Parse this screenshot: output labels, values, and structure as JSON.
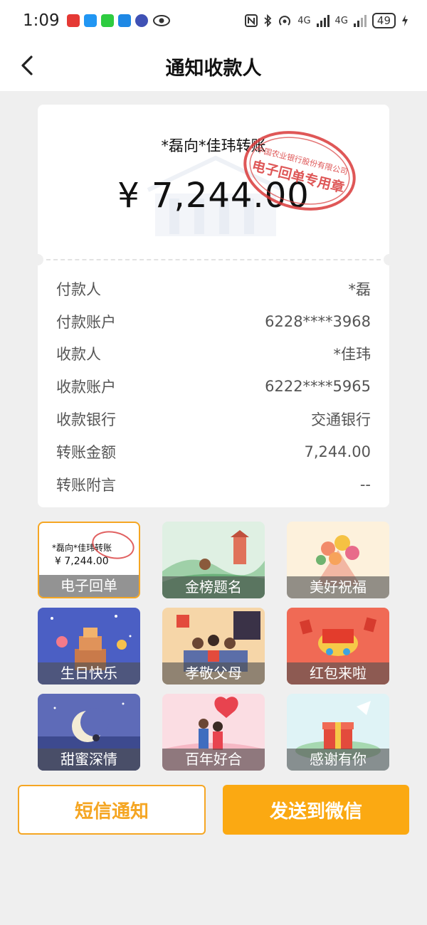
{
  "status_bar": {
    "time": "1:09",
    "network_a": "4G",
    "network_b": "4G",
    "battery": "49"
  },
  "header": {
    "title": "通知收款人"
  },
  "receipt": {
    "title": "*磊向*佳玮转账",
    "amount": "¥ 7,244.00",
    "stamp_lines": [
      "中国农业银行股份有限公司",
      "电子回单专用章"
    ],
    "rows": [
      {
        "label": "付款人",
        "value": "*磊"
      },
      {
        "label": "付款账户",
        "value": "6228****3968"
      },
      {
        "label": "收款人",
        "value": "*佳玮"
      },
      {
        "label": "收款账户",
        "value": "6222****5965"
      },
      {
        "label": "收款银行",
        "value": "交通银行"
      },
      {
        "label": "转账金额",
        "value": "7,244.00"
      },
      {
        "label": "转账附言",
        "value": "--"
      }
    ]
  },
  "templates": [
    {
      "label": "电子回单",
      "mini_title": "*磊向*佳玮转账",
      "mini_amount": "¥ 7,244.00"
    },
    {
      "label": "金榜题名"
    },
    {
      "label": "美好祝福"
    },
    {
      "label": "生日快乐"
    },
    {
      "label": "孝敬父母"
    },
    {
      "label": "红包来啦"
    },
    {
      "label": "甜蜜深情"
    },
    {
      "label": "百年好合"
    },
    {
      "label": "感谢有你"
    }
  ],
  "actions": {
    "sms_label": "短信通知",
    "wechat_label": "发送到微信"
  },
  "colors": {
    "accent": "#fba912",
    "stamp_red": "#d93a3a"
  }
}
